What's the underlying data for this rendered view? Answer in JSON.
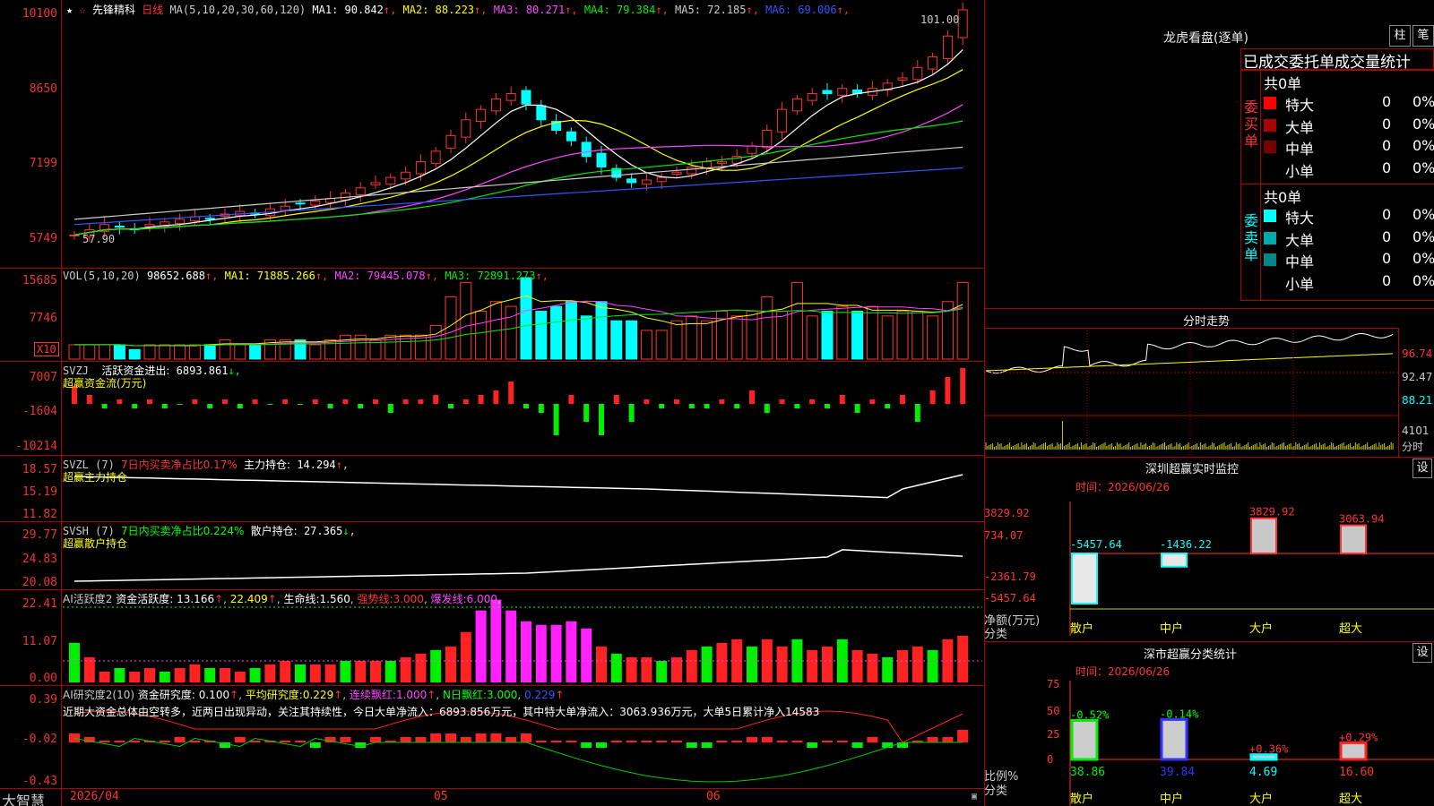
{
  "stock": {
    "name": "先锋精科",
    "period": "日线",
    "ma_header": "MA(5,10,20,30,60,120)",
    "ma": [
      {
        "l": "MA1:",
        "v": "90.842",
        "c": "#ffffff"
      },
      {
        "l": "MA2:",
        "v": "88.223",
        "c": "#ffff00"
      },
      {
        "l": "MA3:",
        "v": "80.271",
        "c": "#ff44ff"
      },
      {
        "l": "MA4:",
        "v": "79.384",
        "c": "#00ee00"
      },
      {
        "l": "MA5:",
        "v": "72.185",
        "c": "#cccccc"
      },
      {
        "l": "MA6:",
        "v": "69.006",
        "c": "#3355ff"
      }
    ]
  },
  "price_axis": [
    "10100",
    "8650",
    "7199",
    "5749"
  ],
  "high_marker": "101.00",
  "low_marker": "57.90",
  "vol": {
    "header": "VOL(5,10,20)",
    "value": "98652.688",
    "ma": [
      {
        "l": "MA1:",
        "v": "71885.266",
        "c": "#ffff00"
      },
      {
        "l": "MA2:",
        "v": "79445.078",
        "c": "#ff44ff"
      },
      {
        "l": "MA3:",
        "v": "72891.273",
        "c": "#00ee00"
      }
    ],
    "axis": [
      "15685",
      "7746"
    ],
    "unit": "X10"
  },
  "svzj": {
    "code": "SVZJ",
    "label": "活跃资金进出:",
    "value": "6893.861",
    "sub": "超赢资金流(万元)",
    "axis": [
      "7007",
      "-1604",
      "-10214"
    ]
  },
  "svzl": {
    "code": "SVZL (7)",
    "t1": "7日内买卖净占比0.17%",
    "t2": "主力持仓:",
    "v2": "14.294",
    "sub": "超赢主力持仓",
    "axis": [
      "18.57",
      "15.19",
      "11.82"
    ]
  },
  "svsh": {
    "code": "SVSH (7)",
    "t1": "7日内买卖净占比0.224%",
    "t2": "散户持仓:",
    "v2": "27.365",
    "sub": "超赢散户持仓",
    "axis": [
      "29.77",
      "24.83",
      "20.08"
    ]
  },
  "ai1": {
    "code": "AI活跃度2",
    "label": "资金活跃度:",
    "v1": "13.166",
    "v2": "22.409",
    "l3": "生命线:",
    "v3": "1.560",
    "l4": "强势线:",
    "v4": "3.000",
    "l5": "爆发线:",
    "v5": "6.000",
    "axis": [
      "22.41",
      "11.07",
      "0.00"
    ]
  },
  "ai2": {
    "code": "AI研究度2(10)",
    "label": "资金研究度:",
    "v1": "0.100",
    "l2": "平均研究度:",
    "v2": "0.229",
    "l3": "连续飘红:",
    "v3": "1.000",
    "l4": "N日飘红:",
    "v4": "3.000",
    "v5": "0.229",
    "axis": [
      "0.39",
      "-0.02",
      "-0.43"
    ],
    "comment": "近期大资金总体由空转多，近两日出现异动，关注其持续性，今日大单净流入：6893.856万元，其中特大单净流入：3063.936万元，大单5日累计净入14583"
  },
  "dates": [
    "2026/04",
    "05",
    "06"
  ],
  "brand": "大智慧",
  "panel": {
    "title": "龙虎看盘(逐单)",
    "btn1": "柱",
    "btn2": "笔",
    "tabs": [
      "已成交",
      "委托单",
      "成交量统计"
    ],
    "buy": {
      "vlabel": "委买单",
      "count": "共0单",
      "rows": [
        {
          "n": "特大",
          "v": "0",
          "p": "0%",
          "c": "#ff0000"
        },
        {
          "n": "大单",
          "v": "0",
          "p": "0%",
          "c": "#aa0000"
        },
        {
          "n": "中单",
          "v": "0",
          "p": "0%",
          "c": "#770000"
        },
        {
          "n": "小单",
          "v": "0",
          "p": "0%",
          "c": "#000"
        }
      ]
    },
    "sell": {
      "vlabel": "委卖单",
      "count": "共0单",
      "rows": [
        {
          "n": "特大",
          "v": "0",
          "p": "0%",
          "c": "#00ffff"
        },
        {
          "n": "大单",
          "v": "0",
          "p": "0%",
          "c": "#00aaaa"
        },
        {
          "n": "中单",
          "v": "0",
          "p": "0%",
          "c": "#008888"
        },
        {
          "n": "小单",
          "v": "0",
          "p": "0%",
          "c": "#000"
        }
      ]
    }
  },
  "intraday": {
    "title": "分时走势",
    "axis": [
      "96.74",
      "92.47",
      "88.21",
      "4101"
    ],
    "vol_label": "分时"
  },
  "sz_monitor": {
    "title": "深圳超赢实时监控",
    "btn": "设",
    "time": "时间：2026/06/26",
    "axis": [
      "3829.92",
      "734.07",
      "0",
      "-2361.79",
      "-5457.64"
    ],
    "ylabel": "净额(万元)",
    "xlabel": "分类",
    "bars": [
      {
        "cat": "散户",
        "val": "-5457.64"
      },
      {
        "cat": "中户",
        "val": "-1436.22"
      },
      {
        "cat": "大户",
        "val": "3829.92"
      },
      {
        "cat": "超大",
        "val": "3063.94"
      }
    ]
  },
  "sz_class": {
    "title": "深市超赢分类统计",
    "btn": "设",
    "time": "时间：2026/06/26",
    "axis": [
      "75",
      "50",
      "25",
      "0"
    ],
    "ylabel": "比例%",
    "xlabel": "分类",
    "bars": [
      {
        "cat": "散户",
        "pct": "-0.52%",
        "val": "38.86"
      },
      {
        "cat": "中户",
        "pct": "-0.14%",
        "val": "39.84"
      },
      {
        "cat": "大户",
        "pct": "+0.36%",
        "val": "4.69"
      },
      {
        "cat": "超大",
        "pct": "+0.29%",
        "val": "16.60"
      }
    ]
  },
  "colors": {
    "up": "#ff2222",
    "down": "#00ffff",
    "grid": "#aa0000",
    "axis_text": "#ff3333"
  }
}
